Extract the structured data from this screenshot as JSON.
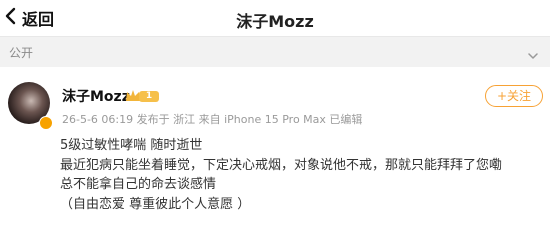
{
  "header": {
    "back_label": "返回",
    "title": "沫子Mozz"
  },
  "section": {
    "label": "公开"
  },
  "post": {
    "username": "沫子Mozz",
    "level_badge": "1",
    "meta": "26-5-6 06:19  发布于 浙江  来自 iPhone 15 Pro Max 已编辑",
    "follow_label": "+关注",
    "lines": [
      "5级过敏性哮喘 随时逝世",
      "最近犯病只能坐着睡觉，下定决心戒烟，对象说他不戒，那就只能拜拜了您嘞",
      "总不能拿自己的命去谈感情",
      "（自由恋爱 尊重彼此个人意愿 ）"
    ]
  },
  "colors": {
    "accent": "#f7a235",
    "section_bg": "#f2f2f2",
    "meta_text": "#9a9a9a"
  }
}
